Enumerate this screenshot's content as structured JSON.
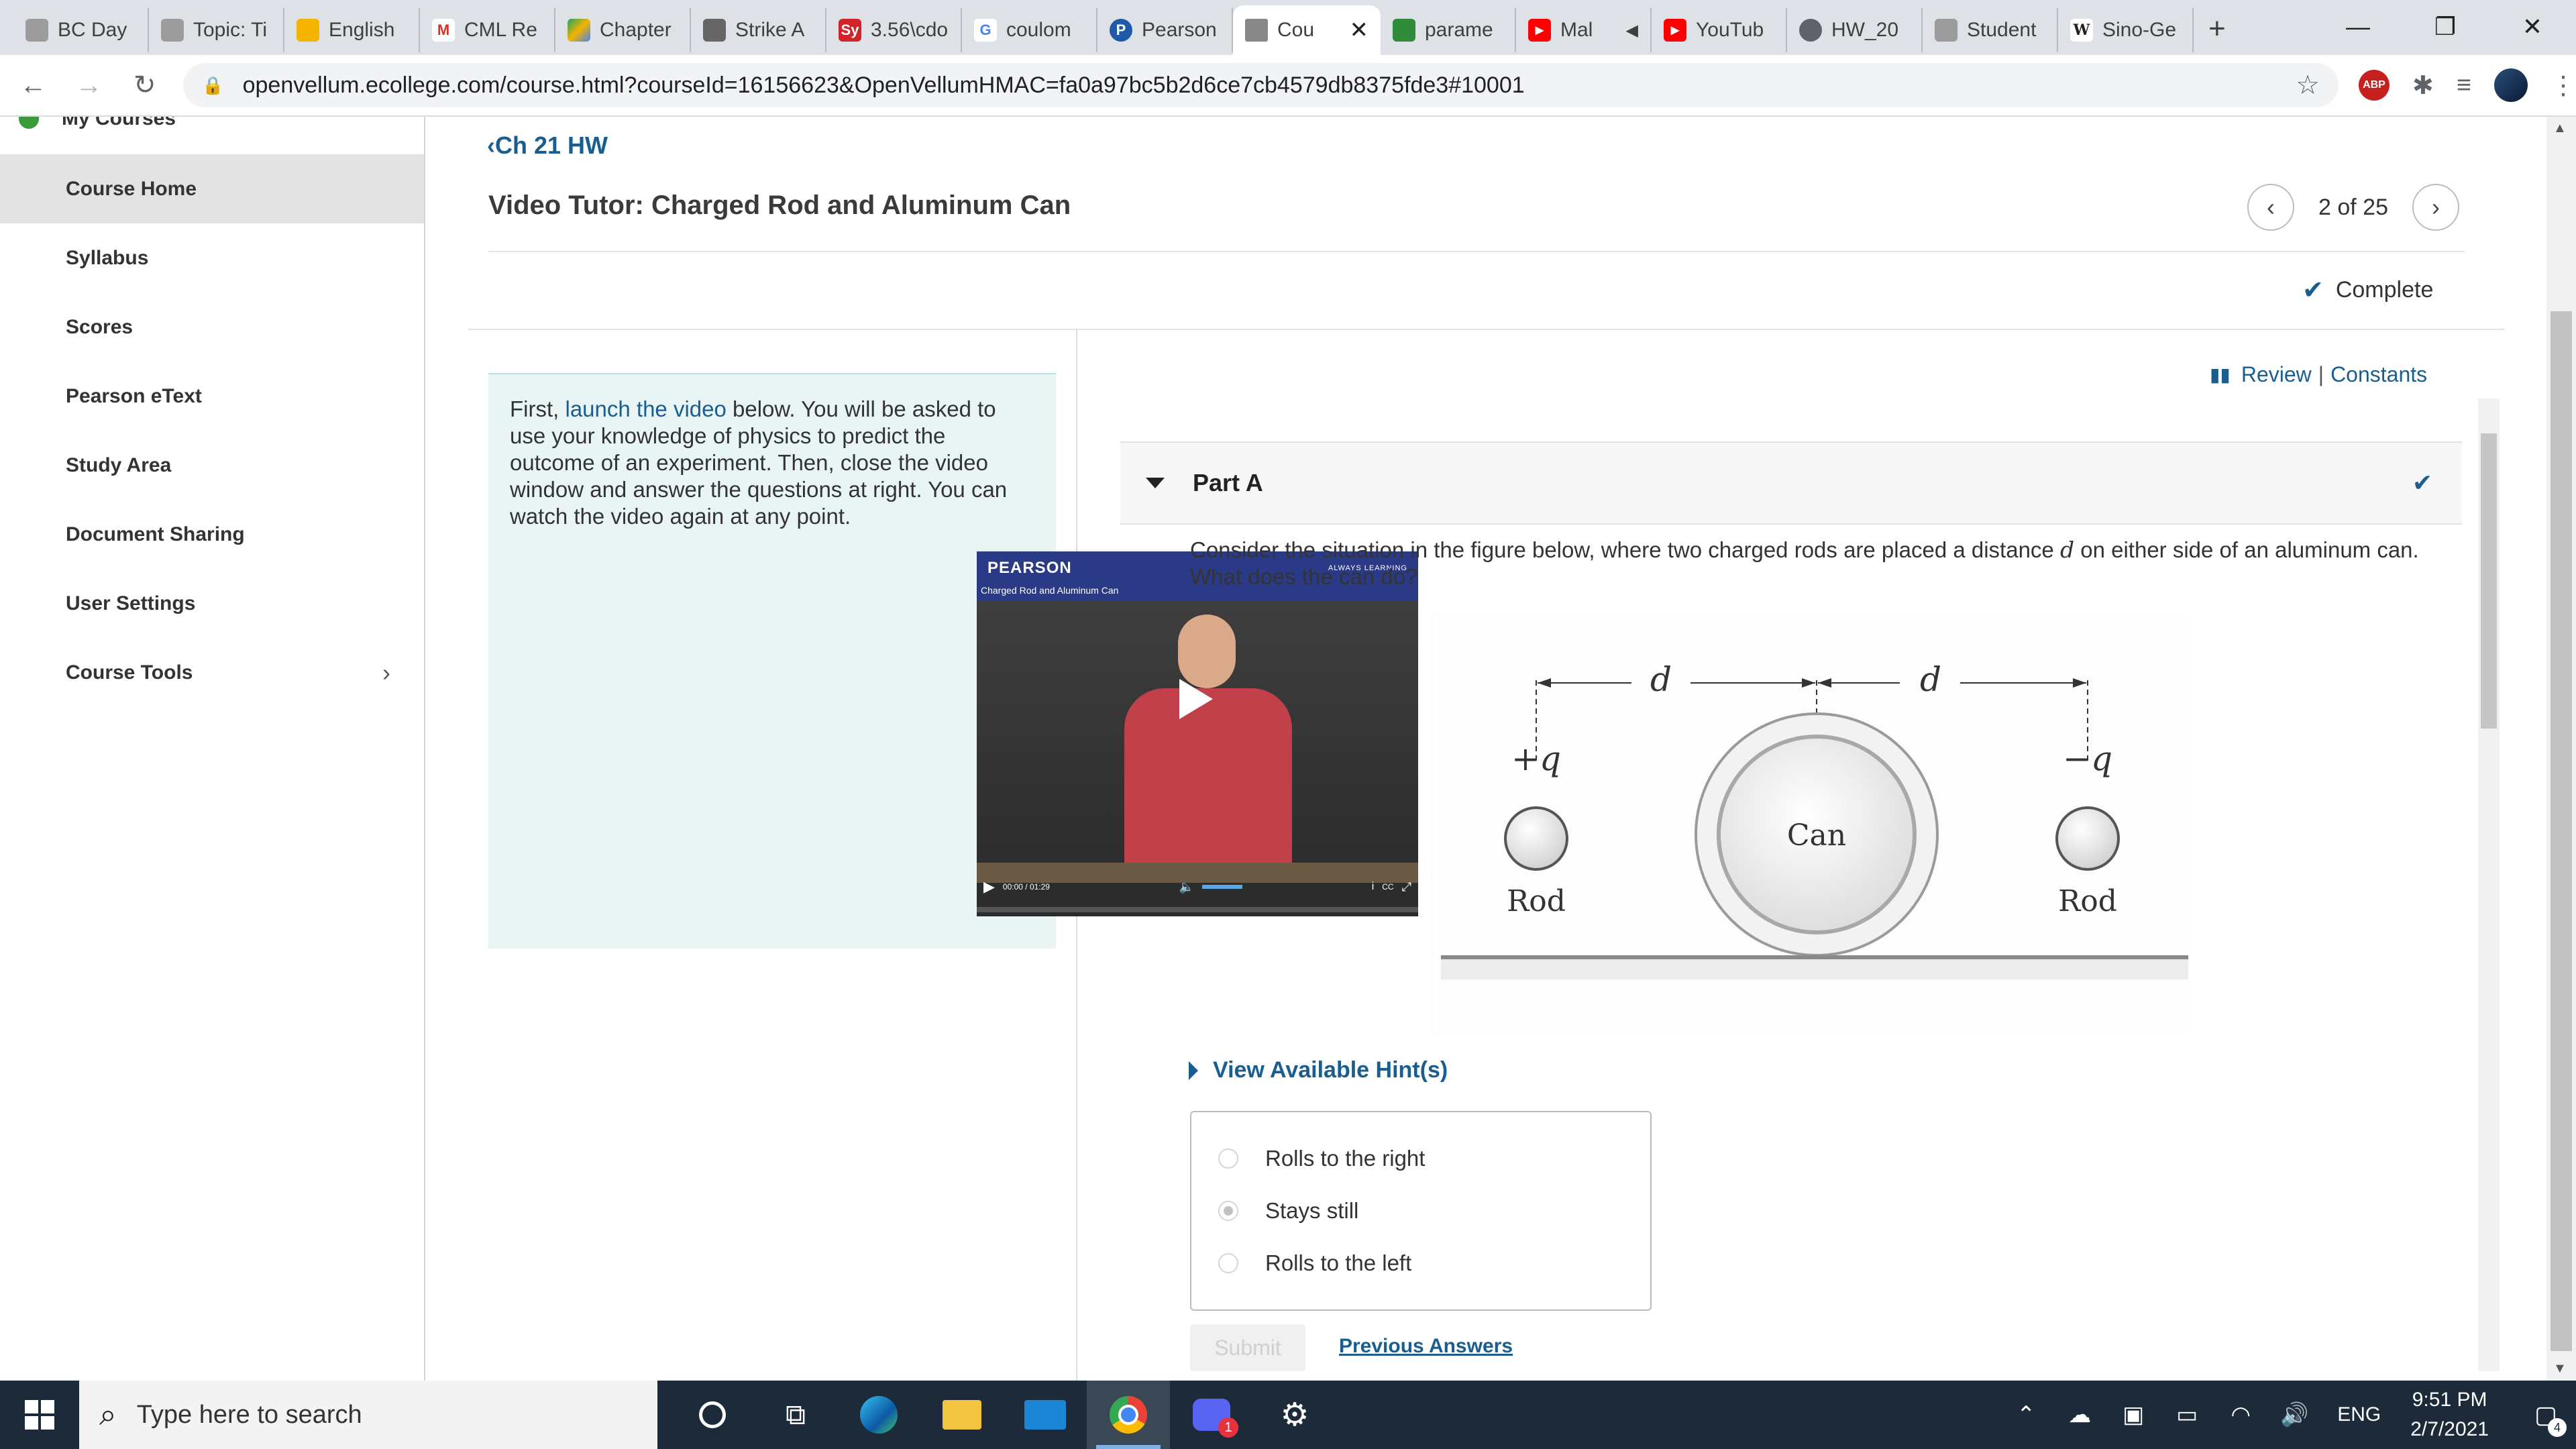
{
  "browser": {
    "tabs": [
      {
        "title": "BC Day",
        "icon": "school-icon",
        "color": "#8a8a8a"
      },
      {
        "title": "Topic: Ti",
        "icon": "school-icon",
        "color": "#8a8a8a"
      },
      {
        "title": "English",
        "icon": "slides-icon",
        "color": "#f4b400"
      },
      {
        "title": "CML Re",
        "icon": "gmail-icon",
        "color": "#d93025"
      },
      {
        "title": "Chapter",
        "icon": "drive-icon",
        "color": "#1fa463"
      },
      {
        "title": "Strike A",
        "icon": "image-icon",
        "color": "#666666"
      },
      {
        "title": "3.56\\cdo",
        "icon": "symbolab-icon",
        "color": "#d0232a"
      },
      {
        "title": "coulom",
        "icon": "google-icon",
        "color": "#4285f4"
      },
      {
        "title": "Pearson",
        "icon": "pearson-icon",
        "color": "#1e5aa8"
      },
      {
        "title": "Cou",
        "icon": "page-icon",
        "color": "#5f6368",
        "active": true
      },
      {
        "title": "parame",
        "icon": "webassign-icon",
        "color": "#2f8a3a"
      },
      {
        "title": "Mal",
        "icon": "youtube-icon",
        "color": "#ff0000"
      },
      {
        "title": "YouTub",
        "icon": "youtube-icon",
        "color": "#ff0000"
      },
      {
        "title": "HW_20",
        "icon": "globe-icon",
        "color": "#5f6368"
      },
      {
        "title": "Student",
        "icon": "school-icon",
        "color": "#8a8a8a"
      },
      {
        "title": "Sino-Ge",
        "icon": "wikipedia-icon",
        "color": "#202124"
      }
    ],
    "new_tab_glyph": "+",
    "url": "openvellum.ecollege.com/course.html?courseId=16156623&OpenVellumHMAC=fa0a97bc5b2d6ce7cb4579db8375fde3#10001",
    "abp_label": "ABP",
    "window_controls": {
      "minimize": "—",
      "restore": "❐",
      "close": "✕"
    }
  },
  "sidebar": {
    "top_partial": "My Courses",
    "items": [
      {
        "label": "Course Home",
        "active": true
      },
      {
        "label": "Syllabus"
      },
      {
        "label": "Scores"
      },
      {
        "label": "Pearson eText"
      },
      {
        "label": "Study Area"
      },
      {
        "label": "Document Sharing"
      },
      {
        "label": "User Settings"
      },
      {
        "label": "Course Tools",
        "has_children": true
      }
    ]
  },
  "main": {
    "breadcrumb": "Ch 21 HW",
    "title": "Video Tutor: Charged Rod and Aluminum Can",
    "pager_text": "2 of 25",
    "status": "Complete",
    "intro": {
      "before_link": "First, ",
      "link": "launch the video",
      "after_link": " below. You will be asked to use your knowledge of physics to predict the outcome of an experiment. Then, close the video window and answer the questions at right. You can watch the video again at any point."
    },
    "video": {
      "brand": "PEARSON",
      "tagline": "ALWAYS LEARNING",
      "subtitle": "Charged Rod and Aluminum Can",
      "time": "00:00 / 01:29",
      "cc": "CC"
    },
    "links": {
      "review": "Review",
      "sep": "|",
      "constants": "Constants"
    },
    "part": {
      "label": "Part A",
      "question_a": "Consider the situation in the figure below, where two charged rods are placed a distance ",
      "question_var": "d",
      "question_b": " on either side of an aluminum can. What does the can do?"
    },
    "figure": {
      "d_left": "d",
      "d_right": "d",
      "left_charge": "+q",
      "right_charge": "−q",
      "can_label": "Can",
      "left_rod_label": "Rod",
      "right_rod_label": "Rod"
    },
    "hints_label": "View Available Hint(s)",
    "options": [
      {
        "label": "Rolls to the right",
        "selected": false
      },
      {
        "label": "Stays still",
        "selected": true
      },
      {
        "label": "Rolls to the left",
        "selected": false
      }
    ],
    "submit_label": "Submit",
    "previous_answers_label": "Previous Answers"
  },
  "taskbar": {
    "search_placeholder": "Type here to search",
    "discord_badge": "1",
    "lang": "ENG",
    "time": "9:51 PM",
    "date": "2/7/2021",
    "notif_count": "4"
  },
  "colors": {
    "link": "#1a5e90",
    "intro_bg": "#e9f5f5",
    "taskbar": "#1c2a3a"
  }
}
